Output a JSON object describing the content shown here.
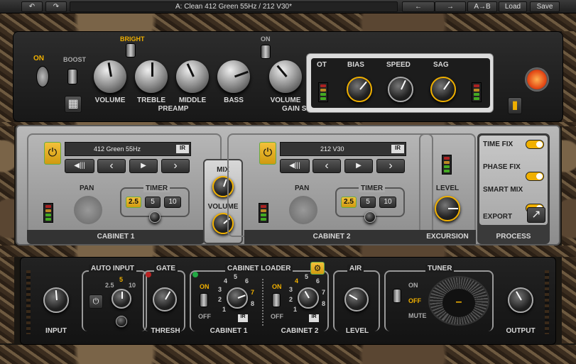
{
  "topbar": {
    "undo": "↶",
    "redo": "↷",
    "preset": "A: Clean 412 Green 55Hz / 212 V30*",
    "prev": "←",
    "next": "→",
    "ab": "A→B",
    "load": "Load",
    "save": "Save"
  },
  "amp": {
    "on": "ON",
    "boost": "BOOST",
    "bright": "BRIGHT",
    "volume": "VOLUME",
    "treble": "TREBLE",
    "middle": "MIDDLE",
    "bass": "BASS",
    "preamp": "PREAMP",
    "switch_on": "ON",
    "volume2": "VOLUME",
    "gain": "GAIN S",
    "ot": "OT",
    "bias": "BIAS",
    "speed": "SPEED",
    "sag": "SAG"
  },
  "cab1": {
    "name": "412 Green 55Hz",
    "ir": "IR",
    "pan": "PAN",
    "timer": "TIMER",
    "t1": "2.5",
    "t2": "5",
    "t3": "10",
    "label": "CABINET  1"
  },
  "cab2": {
    "name": "212 V30",
    "ir": "IR",
    "pan": "PAN",
    "timer": "TIMER",
    "t1": "2.5",
    "t2": "5",
    "t3": "10",
    "label": "CABINET  2"
  },
  "mixer": {
    "mix": "MIX",
    "volume": "VOLUME"
  },
  "excursion": {
    "level": "LEVEL",
    "label": "EXCURSION"
  },
  "process": {
    "time_fix": "TIME FIX",
    "phase_fix": "PHASE FIX",
    "smart_mix": "SMART MIX",
    "export": "EXPORT",
    "label": "PROCESS"
  },
  "bottom": {
    "input": "INPUT",
    "auto_input": "AUTO INPUT",
    "ai25": "2.5",
    "ai5": "5",
    "ai10": "10",
    "gate": "GATE",
    "thresh": "THRESH",
    "cab_loader": "CABINET LOADER",
    "on": "ON",
    "off": "OFF",
    "cabinet1": "CABINET  1",
    "cabinet2": "CABINET  2",
    "ir": "IR",
    "air": "AIR",
    "level": "LEVEL",
    "tuner": "TUNER",
    "t_on": "ON",
    "t_off": "OFF",
    "t_mute": "MUTE",
    "t_readout": "–",
    "output": "OUTPUT",
    "scale": [
      "1",
      "2",
      "3",
      "4",
      "5",
      "6",
      "7",
      "8"
    ]
  },
  "colors": {
    "accent": "#f0b000"
  }
}
